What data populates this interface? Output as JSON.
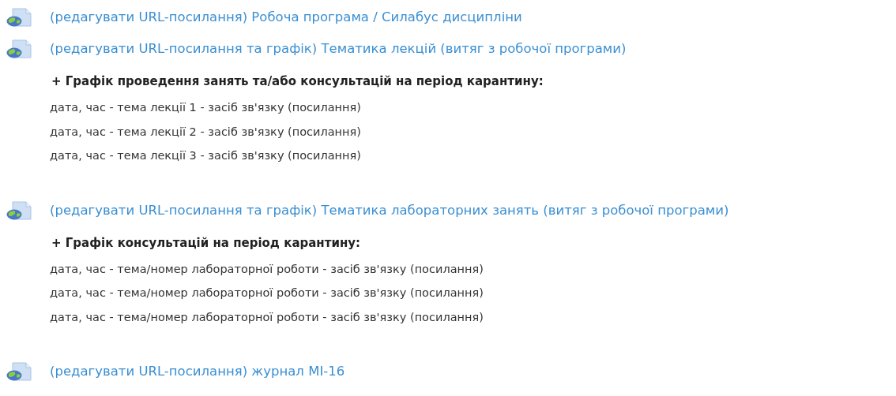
{
  "items": [
    {
      "link": "(редагувати URL-посилання) Робоча програма / Силабус дисципліни"
    },
    {
      "link": "(редагувати URL-посилання та графік) Тематика лекцій (витяг з робочої програми)",
      "schedule": {
        "heading": "+ Графік проведення занять та/або консультацій на період карантину:",
        "lines": [
          "дата, час - тема лекції 1 - засіб зв'язку (посилання)",
          "дата, час - тема лекції 2 - засіб зв'язку (посилання)",
          "дата, час - тема лекції 3 - засіб зв'язку (посилання)"
        ]
      }
    },
    {
      "link": "(редагувати URL-посилання та графік) Тематика лабораторних занять (витяг з робочої програми)",
      "schedule": {
        "heading": "+ Графік консультацій на період карантину:",
        "lines": [
          "дата, час - тема/номер лабораторної роботи - засіб зв'язку (посилання)",
          "дата, час - тема/номер лабораторної роботи - засіб зв'язку (посилання)",
          "дата, час - тема/номер лабораторної роботи - засіб зв'язку (посилання)"
        ]
      }
    },
    {
      "link": "(редагувати URL-посилання) журнал МІ-16"
    }
  ]
}
